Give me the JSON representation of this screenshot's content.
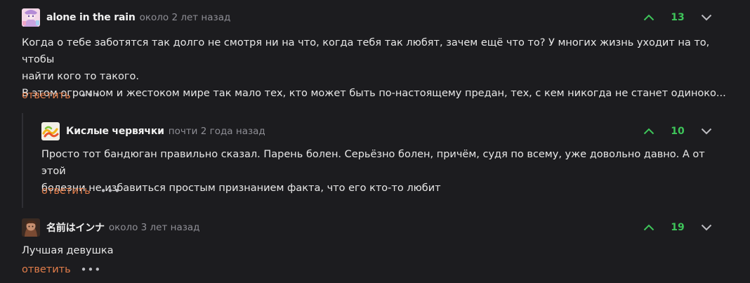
{
  "comments": [
    {
      "author": "alone in the rain",
      "time": "около 2 лет назад",
      "score": "13",
      "body_lines": [
        "Когда о тебе заботятся так долго не смотря ни на что, когда тебя так любят, зачем ещё что то? У многих жизнь уходит на то, чтобы",
        "найти кого то такого.",
        "В этом огромном и жестоком мире так мало тех, кто может быть по-настоящему предан, тех, с кем никогда не станет одиноко..."
      ],
      "reply_label": "ответить",
      "more_label": "•••"
    },
    {
      "author": "Кислые червячки",
      "time": "почти 2 года назад",
      "score": "10",
      "body_lines": [
        "Просто тот бандюган правильно сказал. Парень болен. Серьёзно болен, причём, судя по всему, уже довольно давно. А от этой",
        "болезни не избавиться простым признанием факта, что его кто-то любит"
      ],
      "reply_label": "ответить",
      "more_label": "•••"
    },
    {
      "author": "名前はインナ",
      "time": "около 3 лет назад",
      "score": "19",
      "body_lines": [
        "Лучшая девушка"
      ],
      "reply_label": "ответить",
      "more_label": "•••"
    }
  ],
  "icons": {
    "upvote": "chevron-up-icon",
    "downvote": "chevron-down-icon"
  },
  "colors": {
    "background": "#1c1c1f",
    "score": "#3ec55a",
    "reply": "#e27d4a",
    "time": "#8e8e95"
  }
}
